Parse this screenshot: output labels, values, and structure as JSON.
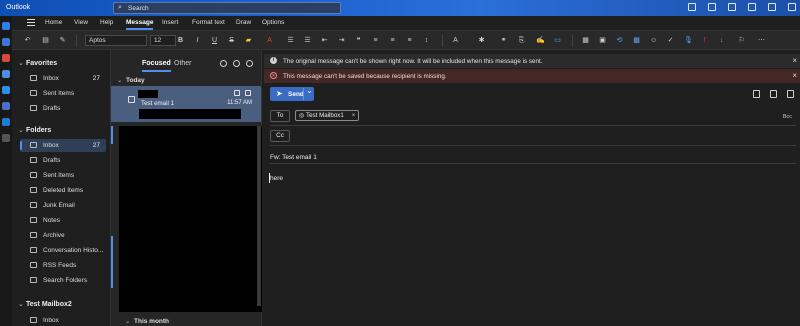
{
  "app": {
    "title": "Outlook"
  },
  "search": {
    "placeholder": "Search"
  },
  "menu": {
    "tabs": [
      "Home",
      "View",
      "Help",
      "Message",
      "Insert",
      "Format text",
      "Draw",
      "Options"
    ],
    "active": "Message"
  },
  "ribbon": {
    "font": "Aptos",
    "size": "12"
  },
  "folders": {
    "favorites_header": "Favorites",
    "favorites": [
      {
        "label": "Inbox",
        "count": "27"
      },
      {
        "label": "Sent Items",
        "count": ""
      },
      {
        "label": "Drafts",
        "count": ""
      }
    ],
    "folders_header": "Folders",
    "items": [
      {
        "label": "Inbox",
        "count": "27"
      },
      {
        "label": "Drafts",
        "count": ""
      },
      {
        "label": "Sent Items",
        "count": ""
      },
      {
        "label": "Deleted Items",
        "count": ""
      },
      {
        "label": "Junk Email",
        "count": ""
      },
      {
        "label": "Notes",
        "count": ""
      },
      {
        "label": "Archive",
        "count": ""
      },
      {
        "label": "Conversation Histo...",
        "count": ""
      },
      {
        "label": "RSS Feeds",
        "count": ""
      },
      {
        "label": "Search Folders",
        "count": ""
      }
    ],
    "mailbox2_header": "Test Mailbox2",
    "mailbox2_items": [
      {
        "label": "Inbox",
        "count": ""
      }
    ]
  },
  "list": {
    "pivot_focused": "Focused",
    "pivot_other": "Other",
    "group_today": "Today",
    "group_month": "This month",
    "message": {
      "subject": "Test email 1",
      "time": "11:57 AM"
    }
  },
  "compose": {
    "info": "The original message can't be shown right now. It will be included when this message is sent.",
    "error": "This message can't be saved because recipient is missing.",
    "send_label": "Send",
    "to_label": "To",
    "cc_label": "Cc",
    "recipient": "Test Mailbox1",
    "bcc_label": "Bcc",
    "subject": "Fw: Test email 1",
    "body": "here"
  },
  "colors": {
    "accent": "#4f8ff0",
    "send_button": "#3a6cc6",
    "error_bar": "#442727",
    "selected_message": "#4a5f7f"
  }
}
